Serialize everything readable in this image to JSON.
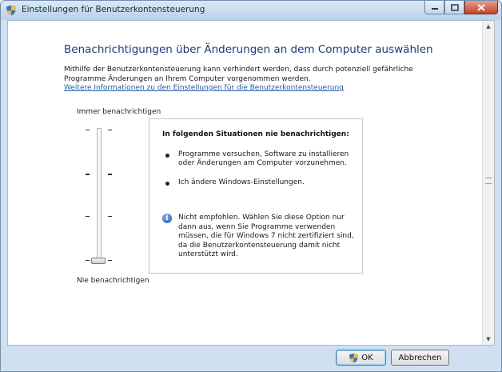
{
  "window": {
    "title": "Einstellungen für Benutzerkontensteuerung",
    "icon": "uac-shield-icon"
  },
  "main": {
    "heading": "Benachrichtigungen über Änderungen an dem Computer auswählen",
    "description": "Mithilfe der Benutzerkontensteuerung kann verhindert werden, dass durch potenziell gefährliche Programme Änderungen an Ihrem Computer vorgenommen werden.",
    "link": "Weitere Informationen zu den Einstellungen für die Benutzerkontensteuerung"
  },
  "slider": {
    "top_label": "Immer benachrichtigen",
    "bottom_label": "Nie benachrichtigen",
    "levels": 4,
    "selected_level": 1
  },
  "info": {
    "title": "In folgenden Situationen nie benachrichtigen:",
    "bullets": [
      "Programme versuchen, Software zu installieren oder Änderungen am Computer vorzunehmen.",
      "Ich ändere Windows-Einstellungen."
    ],
    "notice_icon": "info-icon",
    "notice": "Nicht empfohlen. Wählen Sie diese Option nur dann aus, wenn Sie Programme verwenden müssen, die für Windows 7 nicht zertifiziert sind, da die Benutzerkontensteuerung damit nicht unterstützt wird."
  },
  "buttons": {
    "ok": "OK",
    "cancel": "Abbrechen"
  },
  "colors": {
    "heading": "#1e3a87",
    "link": "#1f59b3",
    "close_button": "#c2432b"
  }
}
